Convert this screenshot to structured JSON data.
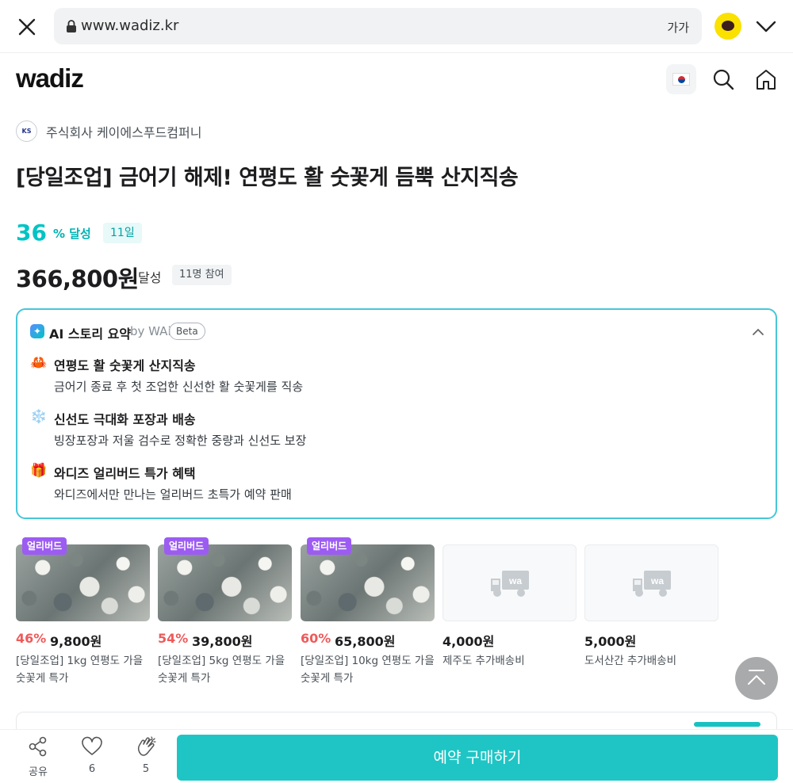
{
  "browser": {
    "url": "www.wadiz.kr",
    "font_size_label": "가가",
    "accent_kakao": "#fae100"
  },
  "header": {
    "logo": "wadiz",
    "language_flag": "korea-flag",
    "icons": [
      "search-icon",
      "home-icon"
    ]
  },
  "project": {
    "maker_logo": "KS",
    "maker_name": "주식회사 케이에스푸드컴퍼니",
    "title": "[당일조업] 금어기 해제! 연평도 활 숫꽃게 듬뿍 산지직송",
    "achievement_percent": "36",
    "achievement_label": "% 달성",
    "days_left": "11일",
    "amount": "366,800원",
    "amount_label": "달성",
    "supporters": "11명 참여",
    "accent": "#00c4c4"
  },
  "ai_summary": {
    "title": "AI 스토리 요약",
    "by": "by WAi",
    "beta": "Beta",
    "items": [
      {
        "emoji": "🦀",
        "heading": "연평도 활 숫꽃게 산지직송",
        "desc": "금어기 종료 후 첫 조업한 신선한 활 숫꽃게를 직송"
      },
      {
        "emoji": "❄️",
        "heading": "신선도 극대화 포장과 배송",
        "desc": "빙장포장과 저울 검수로 정확한 중량과 신선도 보장"
      },
      {
        "emoji": "🎁",
        "heading": "와디즈 얼리버드 특가 혜택",
        "desc": "와디즈에서만 만나는 얼리버드 초특가 예약 판매"
      }
    ]
  },
  "rewards": [
    {
      "badge": "얼리버드",
      "discount": "46%",
      "price": "9,800원",
      "name": "[당일조업] 1kg 연평도 가을 숫꽃게 특가"
    },
    {
      "badge": "얼리버드",
      "discount": "54%",
      "price": "39,800원",
      "name": "[당일조업] 5kg 연평도 가을 숫꽃게 특가"
    },
    {
      "badge": "얼리버드",
      "discount": "60%",
      "price": "65,800원",
      "name": "[당일조업] 10kg 연평도 가을 숫꽃게 특가"
    },
    {
      "badge": "",
      "discount": "",
      "price": "4,000원",
      "name": "제주도 추가배송비",
      "placeholder_text": "wa"
    },
    {
      "badge": "",
      "discount": "",
      "price": "5,000원",
      "name": "도서산간 추가배송비",
      "placeholder_text": "wa"
    }
  ],
  "bottom_bar": {
    "share_label": "공유",
    "like_count": "6",
    "cheer_count": "5",
    "buy_label": "예약 구매하기"
  }
}
